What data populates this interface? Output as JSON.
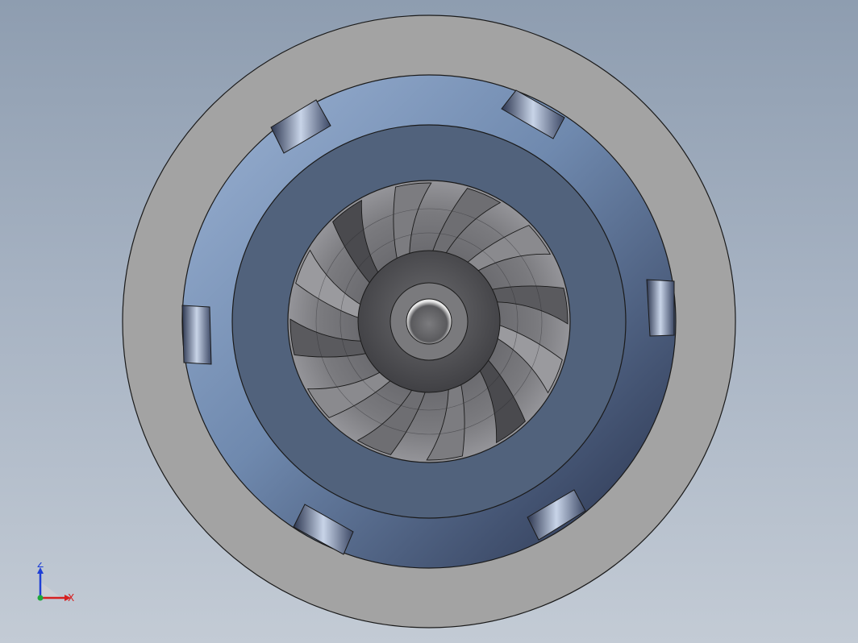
{
  "viewport": {
    "background_top": "#8e9db0",
    "background_bottom": "#c3cbd5"
  },
  "model": {
    "outer_ring_color": "#a3a3a3",
    "housing_color": "#5f7a9e",
    "inner_ring_color": "#51627c",
    "impeller_color": "#5a5a5e",
    "impeller_blade_count": 12,
    "slot_count": 6
  },
  "triad": {
    "z_label": "Z",
    "x_label": "X",
    "z_color": "#1f3fd6",
    "x_color": "#d62020",
    "origin_color": "#1fa83a"
  }
}
